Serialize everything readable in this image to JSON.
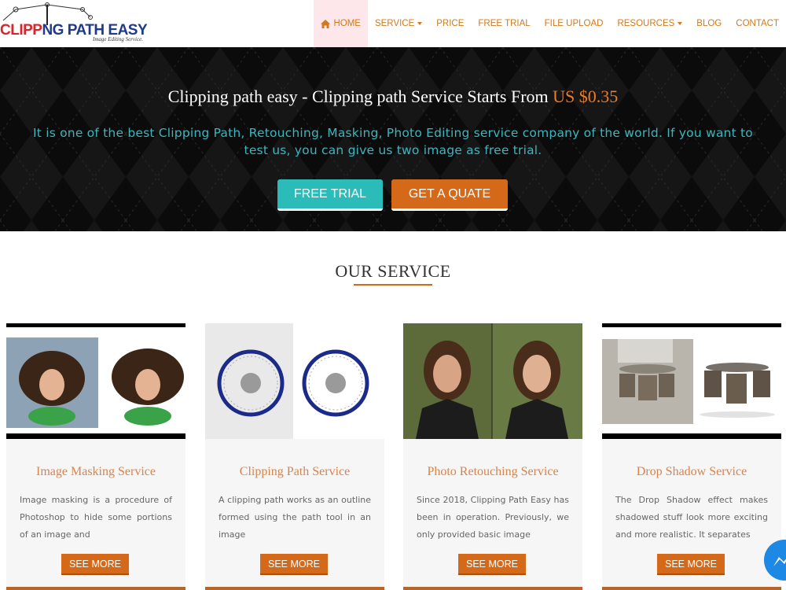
{
  "logo": {
    "name_part1": "CLIPP",
    "name_part2": "NG PATH EASY",
    "tagline": "Image Editing Service."
  },
  "nav": {
    "home": "HOME",
    "service": "SERVICE",
    "price": "PRICE",
    "free_trial": "FREE TRIAL",
    "file_upload": "FILE UPLOAD",
    "resources": "RESOURCES",
    "blog": "BLOG",
    "contact": "CONTACT"
  },
  "hero": {
    "title": "Clipping path easy - Clipping path Service Starts From",
    "price": "US $0.35",
    "desc_line1": "It is one of the best Clipping Path, Retouching, Masking, Photo Editing service company of the world. If you want to",
    "desc_line2": "test us, you can give us two image as free trial.",
    "free_trial_btn": "FREE TRIAL",
    "quote_btn": "GET A QUATE"
  },
  "services": {
    "heading": "OUR SERVICE",
    "cards": [
      {
        "title": "Image Masking Service",
        "text": "Image masking is a procedure of Photoshop to hide some portions of an image and",
        "button": "SEE MORE"
      },
      {
        "title": "Clipping Path Service",
        "text": "A clipping path works as an outline formed using the path tool in an image",
        "button": "SEE MORE"
      },
      {
        "title": "Photo Retouching Service",
        "text": "Since 2018, Clipping Path Easy has been in operation. Previously, we only provided basic image",
        "button": "SEE MORE"
      },
      {
        "title": "Drop Shadow Service",
        "text": "The Drop Shadow effect makes shadowed stuff look more exciting and more realistic. It separates",
        "button": "SEE MORE"
      }
    ]
  },
  "colors": {
    "accent": "#d4691a",
    "teal": "#2bbbb8",
    "nav_text": "#d07a1c",
    "hero_bg": "#0b0b0b"
  },
  "icons": [
    "home-icon",
    "caret-down-icon",
    "messenger-icon"
  ]
}
